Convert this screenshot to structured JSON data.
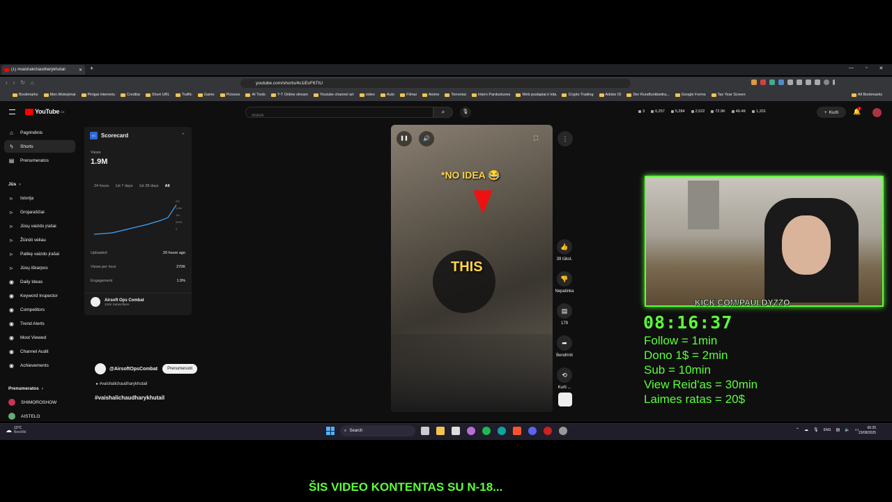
{
  "browser": {
    "tab_title": "(1) #vaishalichaudharykhutail",
    "url": "youtube.com/shorts/4v1iEvF6TtU",
    "bookmarks": [
      "Bookmarks",
      "Men.Mokejimai",
      "Pinigai internetu",
      "Creditai",
      "Short URL",
      "Traffic",
      "Game",
      "Pictures",
      "AI Tools",
      "Y-T Online stream",
      "Youtube channel art",
      "video",
      "Auto",
      "Filmai",
      "Anime",
      "Torrentai",
      "Intern Parduotuves",
      "Web puslapiai ir kita",
      "Crypto Trading",
      "Adobe ID",
      "Der Rundfunkbeitra...",
      "Google Forms",
      "Tax Year Screen"
    ],
    "all_bookmarks": "All Bookmarks"
  },
  "youtube": {
    "logo": "YouTube",
    "logo_region": "DE",
    "search_placeholder": "Ieškoti",
    "stats": [
      "3",
      "6,257",
      "5,284",
      "2,522",
      "72.9K",
      "49.4K",
      "1,201"
    ],
    "create_label": "Kurti",
    "notif_count": "1",
    "sidebar_main": [
      "Pagrindinis",
      "Shorts",
      "Prenumeratos"
    ],
    "you_label": "Jūs",
    "sidebar_you": [
      "Istorija",
      "Grojaraščiai",
      "Jūsų vaizdo įrašai",
      "Žiūrėti vėliau",
      "Patikę vaizdo įrašai",
      "Jūsų iškarpos",
      "Daily Ideas",
      "Keyword Inspector",
      "Competitors",
      "Trend Alerts",
      "Most Viewed",
      "Channel Audit",
      "Achievements"
    ],
    "subs_label": "Prenumeratos",
    "subs": [
      "SHIMOROSHOW",
      "AISTELO"
    ],
    "scorecard": {
      "title": "Scorecard",
      "views_label": "Views",
      "views_value": "1.9M",
      "ranges": [
        "24 hours",
        "1st 7 days",
        "1st 28 days",
        "All"
      ],
      "y_ticks": [
        "2M",
        "1.5M",
        "1M",
        "500K",
        "0"
      ],
      "uploaded_label": "Uploaded",
      "uploaded_value": "20 hours ago",
      "vph_label": "Views per hour",
      "vph_value": "270K",
      "engagement_label": "Engagement",
      "engagement_value": "1.9%",
      "channel_name": "Airsoft Ops Combat",
      "channel_subs": "124K Subscribers"
    },
    "short": {
      "caption1": "*NO IDEA 😂",
      "caption2": "THIS",
      "channel": "@AirsoftOpsCombat",
      "subscribe": "Prenumeruoti",
      "hashtag_small": "#vaishalichaudharykhutail",
      "title": "#vaishalichaudharykhutail"
    },
    "actions": [
      {
        "icon": "thumb-up",
        "label": "39 tūkst."
      },
      {
        "icon": "thumb-down",
        "label": "Nepatinka"
      },
      {
        "icon": "comment",
        "label": "179"
      },
      {
        "icon": "share",
        "label": "Bendrinti"
      },
      {
        "icon": "remix",
        "label": "Kurti ..."
      }
    ]
  },
  "taskbar": {
    "weather_temp": "12°C",
    "weather_desc": "Bewölkt",
    "search": "Search",
    "lang": "ENG",
    "time": "06:25",
    "date": "23/08/2025"
  },
  "stream": {
    "kick": "KICK.COM/PAULDYZZO",
    "timer": "08:16:37",
    "rules": [
      "Follow = 1min",
      "Dono 1$ = 2min",
      "Sub = 10min",
      "View Reid'as = 30min",
      "Laimes ratas = 20$"
    ],
    "subtitle": "ŠIS VIDEO KONTENTAS SU N-18..."
  },
  "colors": {
    "overlay_green": "#5cff3a",
    "yt_red": "#ff0000",
    "yt_bg": "#0f0f0f"
  }
}
